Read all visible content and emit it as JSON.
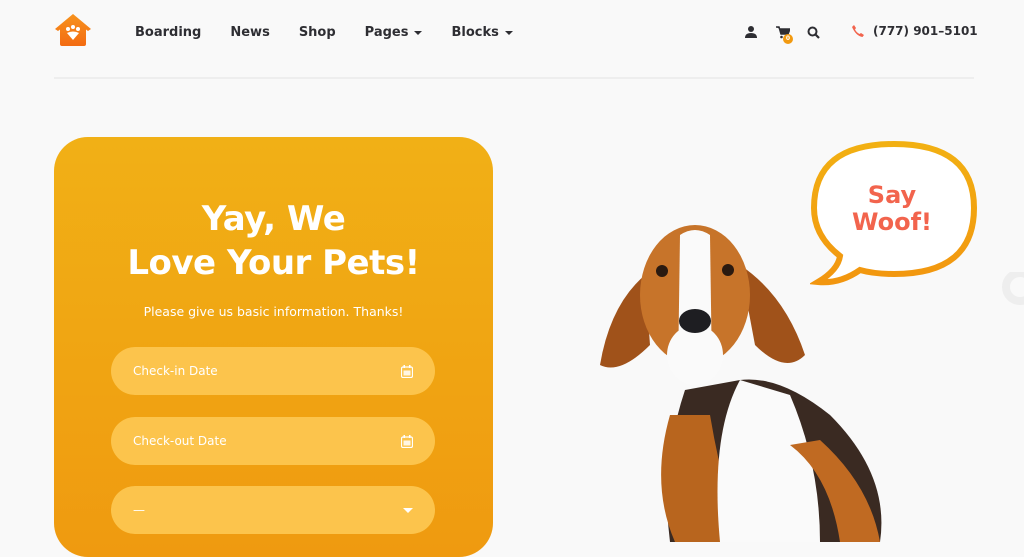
{
  "header": {
    "logo": "house-paw-logo",
    "nav": [
      {
        "label": "Boarding",
        "dropdown": false
      },
      {
        "label": "News",
        "dropdown": false
      },
      {
        "label": "Shop",
        "dropdown": false
      },
      {
        "label": "Pages",
        "dropdown": true
      },
      {
        "label": "Blocks",
        "dropdown": true
      }
    ],
    "icons": {
      "user": "user-icon",
      "cart": "cart-icon",
      "search": "search-icon",
      "phone": "phone-icon"
    },
    "cart_count": "0",
    "phone": "(777) 901–5101"
  },
  "hero": {
    "title_line1": "Yay, We",
    "title_line2": "Love Your Pets!",
    "subtitle": "Please give us basic information. Thanks!",
    "checkin_placeholder": "Check-in Date",
    "checkout_placeholder": "Check-out Date",
    "select_value": "—",
    "speech_line1": "Say",
    "speech_line2": "Woof!"
  },
  "colors": {
    "accent": "#f0a312",
    "field": "#fcc44c",
    "speech_text": "#f2644d",
    "phone_icon": "#f2644d"
  }
}
